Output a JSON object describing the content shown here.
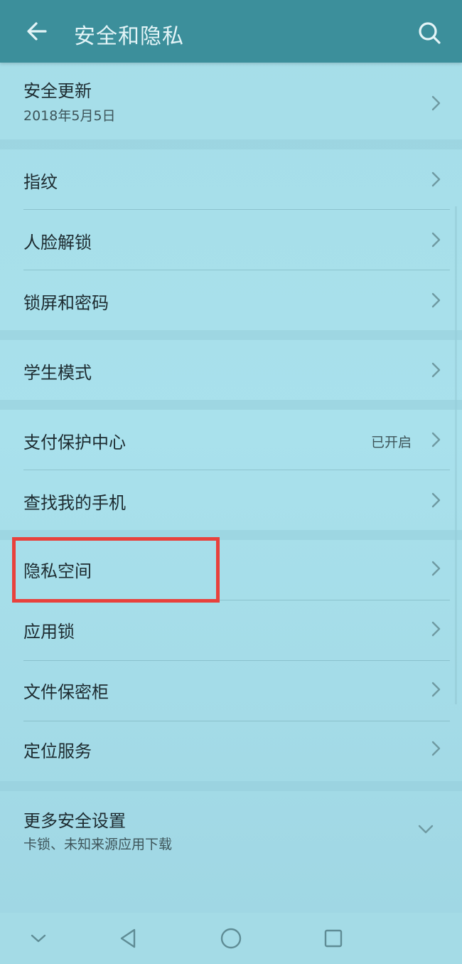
{
  "header": {
    "title": "安全和隐私",
    "back_icon": "arrow-left-icon",
    "search_icon": "search-icon",
    "background": "#3c8f9b"
  },
  "items": [
    {
      "label": "安全更新",
      "sub": "2018年5月5日"
    },
    {
      "label": "指纹"
    },
    {
      "label": "人脸解锁"
    },
    {
      "label": "锁屏和密码"
    },
    {
      "label": "学生模式"
    },
    {
      "label": "支付保护中心",
      "status": "已开启"
    },
    {
      "label": "查找我的手机"
    },
    {
      "label": "隐私空间",
      "highlighted": true
    },
    {
      "label": "应用锁"
    },
    {
      "label": "文件保密柜"
    },
    {
      "label": "定位服务"
    },
    {
      "label": "更多安全设置",
      "sub": "卡锁、未知来源应用下载",
      "expand": true
    }
  ],
  "highlight_color": "#e8413c",
  "navbar": {
    "icons": [
      "chevron-down-icon",
      "back-triangle-icon",
      "home-circle-icon",
      "recents-square-icon"
    ]
  }
}
